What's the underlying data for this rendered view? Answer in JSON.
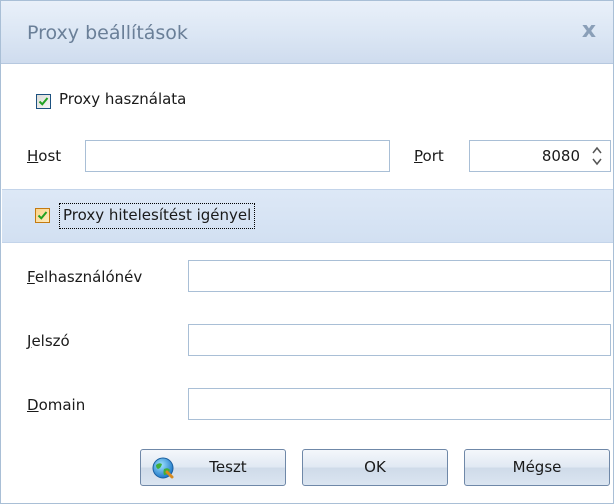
{
  "window": {
    "title": "Proxy beállítások",
    "close_glyph": "x"
  },
  "proxy": {
    "use_label": "Proxy használata",
    "use_checked": true
  },
  "host": {
    "label_u": "H",
    "label_rest": "ost",
    "value": ""
  },
  "port": {
    "label_u": "P",
    "label_rest": "ort",
    "value": "8080"
  },
  "auth": {
    "label": "Proxy hitelesítést igényel",
    "checked": true
  },
  "username": {
    "label_u": "F",
    "label_rest": "elhasználónév",
    "value": ""
  },
  "password": {
    "label_u": "J",
    "label_rest": "elszó",
    "value": ""
  },
  "domain": {
    "label_u": "D",
    "label_rest": "omain",
    "value": ""
  },
  "buttons": {
    "test": "Teszt",
    "ok": "OK",
    "cancel": "Mégse"
  },
  "icons": {
    "close": "close-icon",
    "test": "globe-icon",
    "spin": "spin-arrows-icon",
    "check": "checkmark-icon"
  },
  "colors": {
    "title_bar": "#dbe6f4",
    "section_band": "#d8e4f4",
    "border": "#a9bfd6",
    "title_text": "#6a7f98",
    "checkbox_orange": "#f6b545"
  }
}
